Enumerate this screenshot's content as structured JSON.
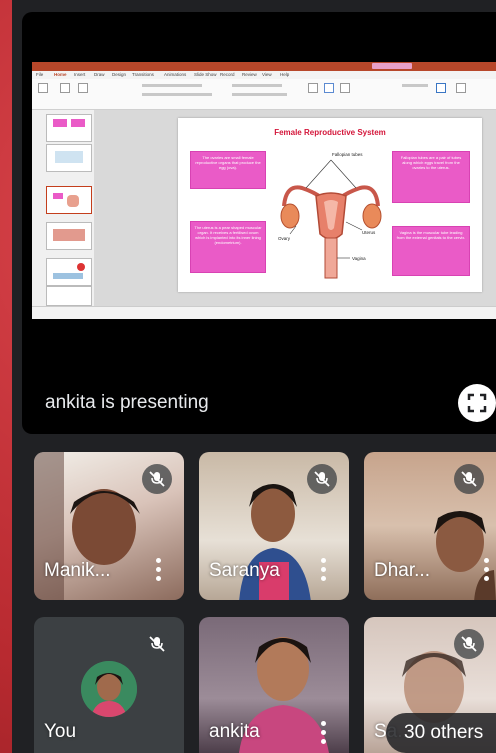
{
  "presentation": {
    "presenter_label": "ankita is presenting",
    "app_window": {
      "menu": [
        "File",
        "Home",
        "Insert",
        "Draw",
        "Design",
        "Transitions",
        "Animations",
        "Slide Show",
        "Record",
        "Review",
        "View",
        "Help"
      ],
      "title": "Female Reproductive System"
    }
  },
  "slide": {
    "title": "Female Reproductive System",
    "boxes": [
      "The ovaries are small female reproductive organs that produce the egg (ova).",
      "The uterus is a pear shaped muscular organ. It receives a fertilised ovum which is implanted into its inner lining (endometrium).",
      "Fallopian tubes are a pair of tubes along which eggs travel from the ovaries to the uterus.",
      "Vagina is the muscular tube leading from the external genitals to the cervix."
    ],
    "diagram_labels": [
      "Fallopian tubes",
      "Ovary",
      "Uterus",
      "Vagina"
    ]
  },
  "participants": [
    {
      "name": "Manik...",
      "muted": true,
      "has_menu": true
    },
    {
      "name": "Saranya",
      "muted": true,
      "has_menu": true
    },
    {
      "name": "Dhar...",
      "muted": true,
      "has_menu": true
    },
    {
      "name": "You",
      "muted": true,
      "has_menu": false
    },
    {
      "name": "ankita",
      "muted": false,
      "has_menu": true
    },
    {
      "name": "Sa...",
      "muted": true,
      "has_menu": false
    }
  ],
  "others_chip": {
    "label": "30 others"
  },
  "colors": {
    "brand_red": "#c43e1c",
    "pink_box": "#ea5bc7",
    "meet_bg": "#202124"
  }
}
